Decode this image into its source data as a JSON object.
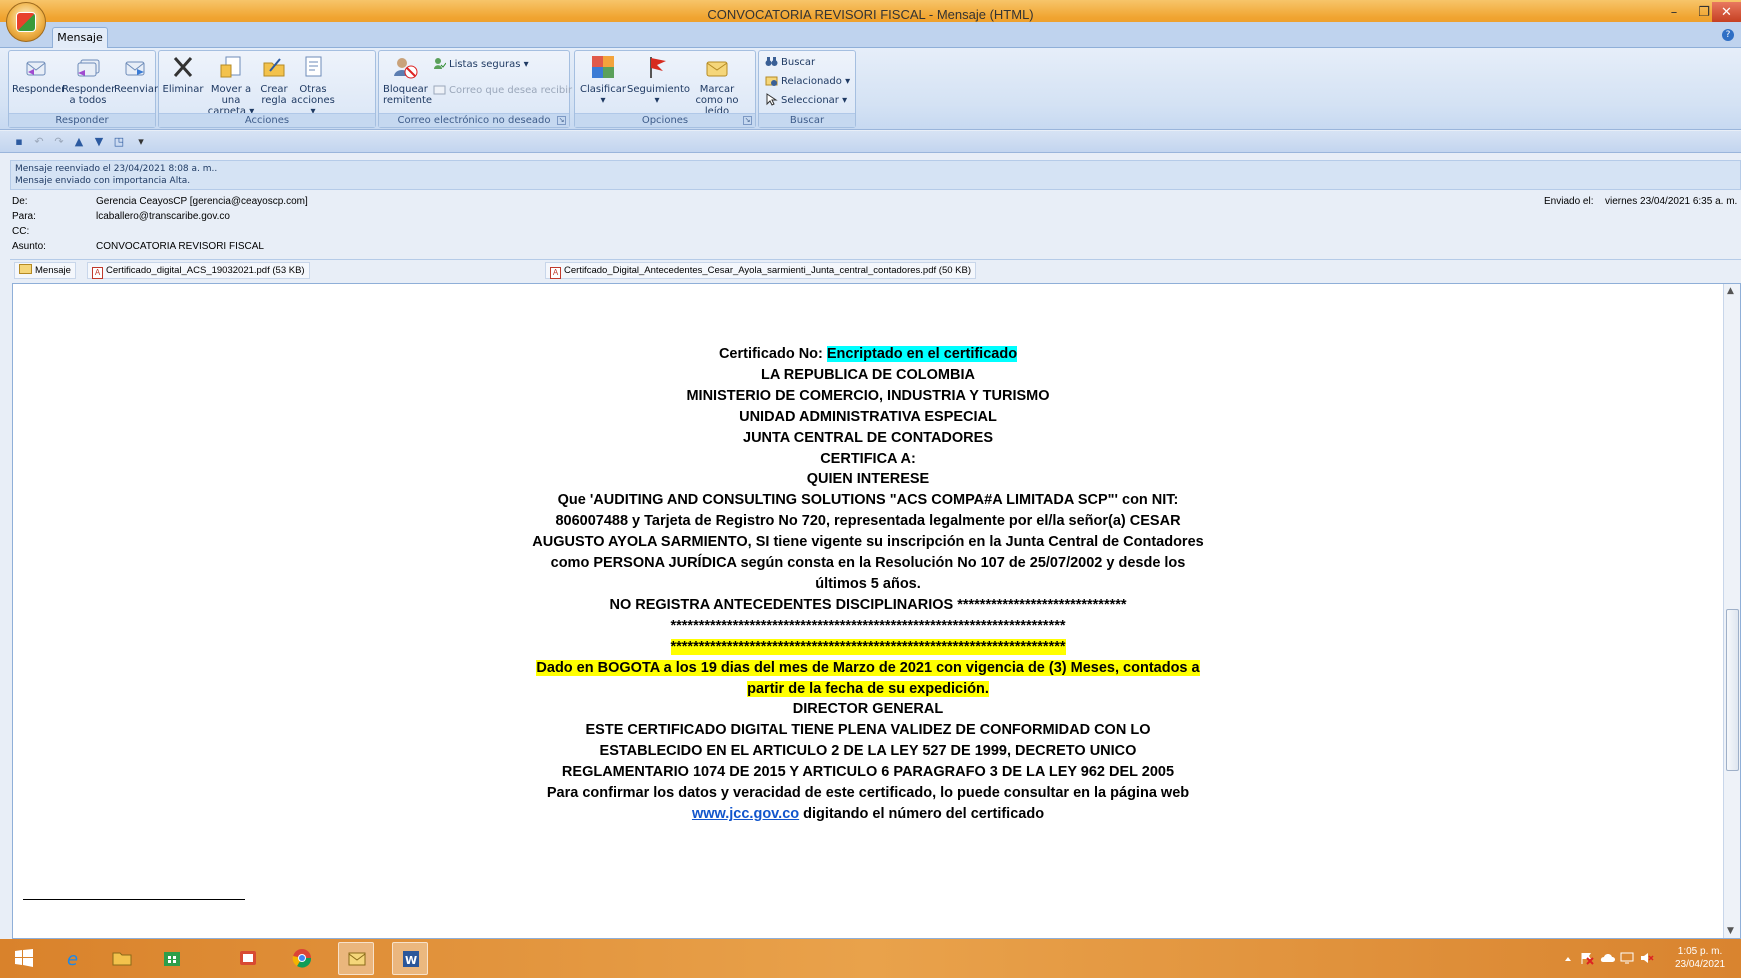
{
  "window": {
    "title": "CONVOCATORIA REVISORI  FISCAL - Mensaje (HTML)",
    "minimize": "–",
    "maximize": "❐",
    "close": "✕"
  },
  "ribbon": {
    "tab": "Mensaje",
    "help": "?",
    "groups": {
      "responder": {
        "label": "Responder",
        "buttons": [
          "Responder",
          "Responder a todos",
          "Reenviar"
        ]
      },
      "acciones": {
        "label": "Acciones",
        "eliminar": "Eliminar",
        "mover": "Mover a una carpeta ▾",
        "crear_regla": "Crear regla",
        "otras": "Otras acciones ▾"
      },
      "correo": {
        "label": "Correo electrónico no deseado",
        "bloquear": "Bloquear remitente",
        "listas": "Listas seguras ▾",
        "correo_que_desea": "Correo que desea recibir"
      },
      "opciones": {
        "label": "Opciones",
        "clasificar": "Clasificar ▾",
        "seguimiento": "Seguimiento ▾",
        "marcar": "Marcar como no leído"
      },
      "buscar": {
        "label": "Buscar",
        "buscar": "Buscar",
        "relacionado": "Relacionado ▾",
        "seleccionar": "Seleccionar ▾"
      }
    }
  },
  "infobar": {
    "line1": "Mensaje reenviado el 23/04/2021 8:08 a. m..",
    "line2": "Mensaje enviado con importancia Alta."
  },
  "header": {
    "de_label": "De:",
    "de_value": "Gerencia CeayosCP [gerencia@ceayoscp.com]",
    "para_label": "Para:",
    "para_value": "lcaballero@transcaribe.gov.co",
    "cc_label": "CC:",
    "cc_value": "",
    "asunto_label": "Asunto:",
    "asunto_value": "CONVOCATORIA REVISORI  FISCAL",
    "enviado_label": "Enviado el:",
    "enviado_value": "viernes 23/04/2021 6:35 a. m."
  },
  "attachments": {
    "mensaje": "Mensaje",
    "file1": "Certificado_digital_ACS_19032021.pdf (53 KB)",
    "file2": "Certifcado_Digital_Antecedentes_Cesar_Ayola_sarmienti_Junta_central_contadores.pdf (50 KB)"
  },
  "body": {
    "cert_no_label": "Certificado No:",
    "cert_no_value": "Encriptado en  el  certificado",
    "l1": "LA REPUBLICA DE COLOMBIA",
    "l2": "MINISTERIO DE COMERCIO, INDUSTRIA Y TURISMO",
    "l3": "UNIDAD ADMINISTRATIVA ESPECIAL",
    "l4": "JUNTA CENTRAL DE CONTADORES",
    "l5": "CERTIFICA A:",
    "l6": "QUIEN INTERESE",
    "p1a": "Que 'AUDITING AND CONSULTING SOLUTIONS \"ACS COMPA#A LIMITADA SCP\"' con NIT:",
    "p1b": "806007488 y Tarjeta de Registro No 720, representada legalmente por el/la señor(a) CESAR",
    "p1c": "AUGUSTO AYOLA SARMIENTO, SI tiene vigente su inscripción en la Junta Central de Contadores",
    "p1d": "como PERSONA JURÍDICA según consta en la Resolución No 107 de 25/07/2002 y desde los",
    "p1e": "últimos 5 años.",
    "no_registra": "NO REGISTRA ANTECEDENTES DISCIPLINARIOS ******************************",
    "stars1": "**********************************************************************",
    "stars2": "**********************************************************************",
    "dado1": "Dado en BOGOTA a los 19 dias del mes de Marzo de 2021 con vigencia de (3) Meses, contados a",
    "dado2": "partir de la fecha de su expedición.",
    "director": "DIRECTOR GENERAL",
    "v1": "ESTE CERTIFICADO DIGITAL TIENE PLENA VALIDEZ DE CONFORMIDAD CON LO",
    "v2": "ESTABLECIDO EN EL ARTICULO 2 DE LA LEY 527 DE 1999, DECRETO UNICO",
    "v3": "REGLAMENTARIO 1074 DE 2015 Y ARTICULO 6 PARAGRAFO 3 DE LA LEY 962 DEL 2005",
    "v4": "Para confirmar los datos y veracidad de este certificado, lo puede consultar en la página web",
    "link": "www.jcc.gov.co",
    "v5": " digitando el número del certificado"
  },
  "taskbar": {
    "time": "1:05 p. m.",
    "date": "23/04/2021"
  },
  "colors": {
    "cyan_highlight": "#00ffff",
    "yellow_highlight": "#ffff00",
    "link": "#1155cc",
    "taskbar": "#e9a24b",
    "titlebar": "#f0a430"
  }
}
